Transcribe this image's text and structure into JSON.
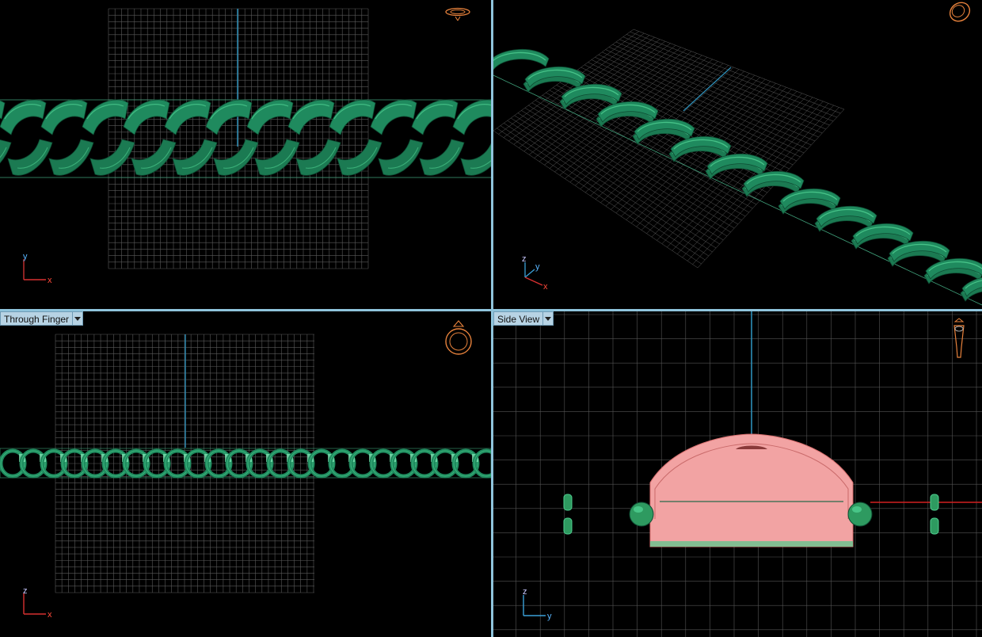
{
  "app": {
    "colors": {
      "background": "#000000",
      "grid": "#7a7a7a",
      "axis_blue": "#2e8fb8",
      "axis_red": "#d22020",
      "chain_green": "#1f8a5e",
      "chain_light": "#4fd091",
      "selection_pink": "#f2a3a3",
      "gizmo_orange": "#e8823c",
      "viewport_border": "#8fc4dc"
    }
  },
  "viewports": {
    "top_left": {
      "axes": {
        "h": "x",
        "v": "y"
      },
      "gizmo_icon": "ring-top-icon"
    },
    "top_right": {
      "axes": {
        "z": "z",
        "y": "y",
        "x": "x"
      },
      "gizmo_icon": "ring-perspective-icon"
    },
    "bottom_left": {
      "label": "Through Finger",
      "axes": {
        "h": "x",
        "v": "z"
      },
      "gizmo_icon": "ring-front-icon"
    },
    "bottom_right": {
      "label": "Side View",
      "axes": {
        "h": "y",
        "v": "z"
      },
      "gizmo_icon": "ring-side-icon"
    }
  }
}
